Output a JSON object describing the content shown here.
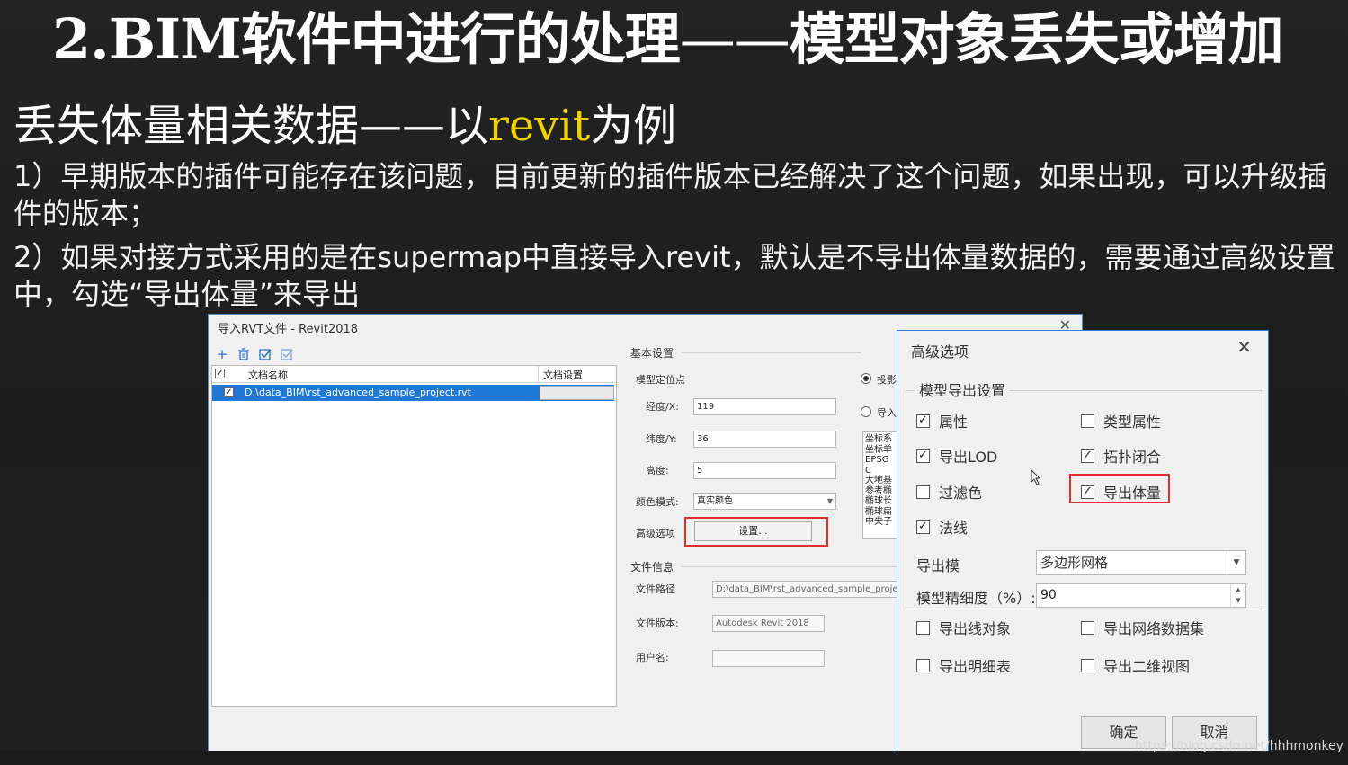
{
  "slide": {
    "title_main": "2.BIM软件中进行的处理",
    "title_dash": "——",
    "title_tail": "模型对象丢失或增加",
    "subtitle_pre": "丢失体量相关数据——以",
    "subtitle_hl": "revit",
    "subtitle_post": "为例",
    "point1": "1）早期版本的插件可能存在该问题，目前更新的插件版本已经解决了这个问题，如果出现，可以升级插件的版本；",
    "point2": "2）如果对接方式采用的是在supermap中直接导入revit，默认是不导出体量数据的，需要通过高级设置中，勾选“导出体量”来导出",
    "highlight_color": "#f0d200"
  },
  "import_window": {
    "title": "导入RVT文件 - Revit2018",
    "close": "✕",
    "toolbar": {
      "add": "+",
      "delete": "🗑",
      "check": "☑",
      "uncheck": "☐"
    },
    "list": {
      "col_name": "文档名称",
      "col_settings": "文档设置",
      "row_path": "D:\\data_BIM\\rst_advanced_sample_project.rvt",
      "row_checked": "✓",
      "head_checked": "✓"
    },
    "basic": {
      "group": "基本设置",
      "locate": "模型定位点",
      "lon_label": "经度/X:",
      "lon_value": "119",
      "lat_label": "纬度/Y:",
      "lat_value": "36",
      "height_label": "高度:",
      "height_value": "5",
      "color_mode_label": "颜色模式:",
      "color_mode_value": "真实颜色",
      "advanced_label": "高级选项",
      "settings_button": "设置...",
      "radio1": "投影",
      "radio2": "导入",
      "coord_lines": [
        "坐标系",
        "坐标单",
        "EPSG C",
        "大地基",
        "参考椭",
        "椭球长",
        "椭球扁",
        "中央子"
      ]
    },
    "file_info": {
      "group": "文件信息",
      "path_label": "文件路径",
      "path_value": "D:\\data_BIM\\rst_advanced_sample_project",
      "version_label": "文件版本:",
      "version_value": "Autodesk Revit 2018",
      "user_label": "用户名:",
      "user_value": ""
    }
  },
  "advanced_dialog": {
    "title": "高级选项",
    "close": "✕",
    "group": "模型导出设置",
    "checkboxes": [
      {
        "label": "属性",
        "checked": "✓"
      },
      {
        "label": "类型属性",
        "checked": ""
      },
      {
        "label": "导出LOD",
        "checked": "✓"
      },
      {
        "label": "拓扑闭合",
        "checked": "✓"
      },
      {
        "label": "过滤色",
        "checked": ""
      },
      {
        "label": "导出体量",
        "checked": "✓"
      },
      {
        "label": "法线",
        "checked": "✓"
      }
    ],
    "export_mode_label": "导出模",
    "export_mode_value": "多边形网格",
    "precision_label": "模型精细度（%）:",
    "precision_value": "90",
    "extra_checkboxes": [
      {
        "label": "导出线对象",
        "checked": ""
      },
      {
        "label": "导出网络数据集",
        "checked": ""
      },
      {
        "label": "导出明细表",
        "checked": ""
      },
      {
        "label": "导出二维视图",
        "checked": ""
      }
    ],
    "ok": "确定",
    "cancel": "取消"
  },
  "watermark": "https://blog.csdn.net/hhhmonkey",
  "colors": {
    "highlight_border": "#e0312b",
    "selected_row": "#1e78d7",
    "dialog_border": "#2f7fd6"
  }
}
